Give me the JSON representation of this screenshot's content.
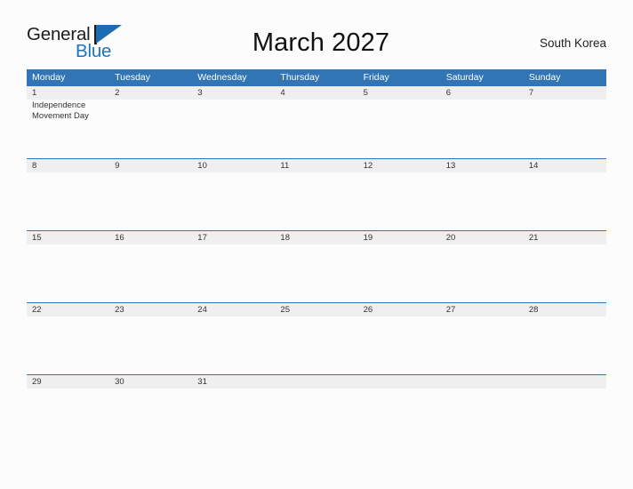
{
  "logo": {
    "word1": "General",
    "word2": "Blue",
    "flag_icon": "triangle-flag-icon",
    "color_dark": "#1c1c1c",
    "color_blue": "#1b75bb"
  },
  "header": {
    "title": "March 2027",
    "country": "South Korea"
  },
  "colors": {
    "header_blue": "#3175b5",
    "row_divider_blue": "#2e75b6",
    "band_gray": "#efefef",
    "page_background": "#fcfcfd",
    "text": "#333333"
  },
  "calendar": {
    "month": "March",
    "year": "2027",
    "weekday_headers": [
      "Monday",
      "Tuesday",
      "Wednesday",
      "Thursday",
      "Friday",
      "Saturday",
      "Sunday"
    ],
    "weeks": [
      {
        "days": [
          {
            "num": "1",
            "events": [
              "Independence Movement Day"
            ]
          },
          {
            "num": "2",
            "events": []
          },
          {
            "num": "3",
            "events": []
          },
          {
            "num": "4",
            "events": []
          },
          {
            "num": "5",
            "events": []
          },
          {
            "num": "6",
            "events": []
          },
          {
            "num": "7",
            "events": []
          }
        ]
      },
      {
        "days": [
          {
            "num": "8",
            "events": []
          },
          {
            "num": "9",
            "events": []
          },
          {
            "num": "10",
            "events": []
          },
          {
            "num": "11",
            "events": []
          },
          {
            "num": "12",
            "events": []
          },
          {
            "num": "13",
            "events": []
          },
          {
            "num": "14",
            "events": []
          }
        ]
      },
      {
        "days": [
          {
            "num": "15",
            "events": []
          },
          {
            "num": "16",
            "events": []
          },
          {
            "num": "17",
            "events": []
          },
          {
            "num": "18",
            "events": []
          },
          {
            "num": "19",
            "events": []
          },
          {
            "num": "20",
            "events": []
          },
          {
            "num": "21",
            "events": []
          }
        ]
      },
      {
        "days": [
          {
            "num": "22",
            "events": []
          },
          {
            "num": "23",
            "events": []
          },
          {
            "num": "24",
            "events": []
          },
          {
            "num": "25",
            "events": []
          },
          {
            "num": "26",
            "events": []
          },
          {
            "num": "27",
            "events": []
          },
          {
            "num": "28",
            "events": []
          }
        ]
      },
      {
        "days": [
          {
            "num": "29",
            "events": []
          },
          {
            "num": "30",
            "events": []
          },
          {
            "num": "31",
            "events": []
          },
          {
            "num": "",
            "events": []
          },
          {
            "num": "",
            "events": []
          },
          {
            "num": "",
            "events": []
          },
          {
            "num": "",
            "events": []
          }
        ]
      }
    ]
  }
}
